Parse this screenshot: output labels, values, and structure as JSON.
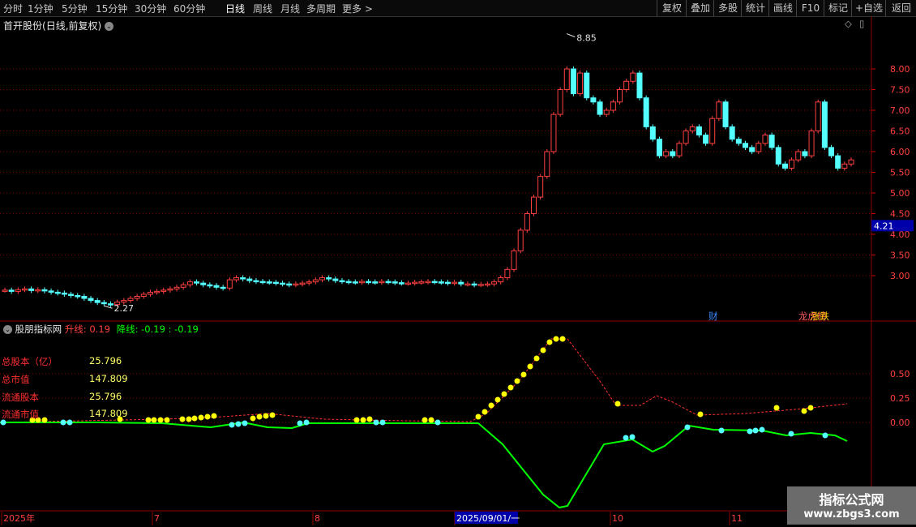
{
  "toolbar": {
    "timeframes": [
      "分时",
      "1分钟",
      "5分钟",
      "15分钟",
      "30分钟",
      "60分钟",
      "日线",
      "周线",
      "月线",
      "多周期",
      "更多"
    ],
    "active_timeframe": "日线",
    "right_buttons": [
      "复权",
      "叠加",
      "多股",
      "统计",
      "画线",
      "F10",
      "标记",
      "+自选",
      "返回"
    ]
  },
  "stock": {
    "name": "首开股份",
    "mode": "(日线,前复权)"
  },
  "main_chart": {
    "y_ticks": [
      "8.00",
      "7.50",
      "7.00",
      "6.50",
      "6.00",
      "5.50",
      "5.00",
      "4.50",
      "4.00",
      "3.50",
      "3.00"
    ],
    "current_price_tag": "4.21",
    "high_marker": "8.85",
    "low_marker": "2.27",
    "badges": [
      {
        "text": "财",
        "color": "#3a8aff"
      },
      {
        "text": "龙虎榜",
        "color": "#ff5a5a"
      },
      {
        "text": "涨跌",
        "color": "#ffcc00"
      }
    ]
  },
  "indicator": {
    "title": "股朋指标网",
    "up_label": "升线:",
    "up_value": "0.19",
    "down_label": "降线:",
    "down_value": "-0.19",
    "down_value2": ": -0.19",
    "y_ticks": [
      "0.50",
      "0.25",
      "0.00"
    ],
    "fundamentals": [
      {
        "label": "总股本（亿）",
        "value": "25.796"
      },
      {
        "label": "总市值",
        "value": "147.809"
      },
      {
        "label": "流通股本",
        "value": "25.796"
      },
      {
        "label": "流通市值",
        "value": "147.809"
      }
    ]
  },
  "x_axis": {
    "labels": [
      "2025年",
      "7",
      "8",
      "2025/09/01/一",
      "10",
      "11"
    ]
  },
  "watermark": {
    "line1": "指标公式网",
    "line2": "www.zbgs3.com"
  },
  "colors": {
    "up": "#ff4040",
    "down": "#54ffff",
    "grid": "#8b0000",
    "yellow": "#ffff00",
    "green": "#00ff00"
  }
}
